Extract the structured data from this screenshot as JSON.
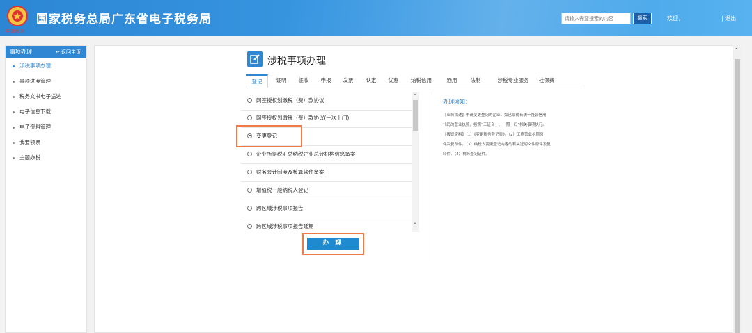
{
  "header": {
    "title": "国家税务总局广东省电子税务局",
    "logo_text": "中国税务",
    "search_placeholder": "请输入需要搜索的内容",
    "search_button": "搜索",
    "welcome": "欢迎，",
    "logout": "| 退出"
  },
  "sidebar": {
    "header": "事项办理",
    "back_link": "↩ 返回主页",
    "items": [
      {
        "label": "涉税事项办理"
      },
      {
        "label": "事项进度管理"
      },
      {
        "label": "税务文书电子送达"
      },
      {
        "label": "电子信息下载"
      },
      {
        "label": "电子资料管理"
      },
      {
        "label": "我要领票"
      },
      {
        "label": "主题办税"
      }
    ]
  },
  "panel": {
    "title": "涉税事项办理",
    "tabs": [
      {
        "label": "登记"
      },
      {
        "label": "证明"
      },
      {
        "label": "征收"
      },
      {
        "label": "申报"
      },
      {
        "label": "发票"
      },
      {
        "label": "认定"
      },
      {
        "label": "优惠"
      },
      {
        "label": "纳税信用"
      },
      {
        "label": "通用"
      },
      {
        "label": "法制"
      },
      {
        "label": "涉税专业服务"
      },
      {
        "label": "社保费"
      }
    ],
    "items": [
      {
        "label": "网签授权划缴税（费）款协议"
      },
      {
        "label": "网签授权划缴税（费）款协议(一次上门)"
      },
      {
        "label": "变更登记"
      },
      {
        "label": "企业所得税汇总纳税企业总分机构信息备案"
      },
      {
        "label": "财务会计制度及核算软件备案"
      },
      {
        "label": "增值税一般纳税人登记"
      },
      {
        "label": "跨区域涉税事项报告"
      },
      {
        "label": "跨区域涉税事项报告延期"
      }
    ],
    "selected_item": "变更登记",
    "submit_button": "办 理"
  },
  "notice": {
    "title": "办理须知：",
    "lines": [
      "【业务描述】申请变更登记的企业，如已取得有统一社会信用",
      "代码的营业执照，按照“三证合一、一照一码”相关事项执行。",
      "【报送资料】（1）《变更税务登记表》。（2）工商营业执照原",
      "件及复印件。（3）纳税人变更登记内容的有关证明文件原件及复",
      "印件。（4）税务登记证件。"
    ]
  },
  "colors": {
    "header": "#2c86d4",
    "accent": "#2f86d2",
    "highlight": "#ee7a45"
  }
}
